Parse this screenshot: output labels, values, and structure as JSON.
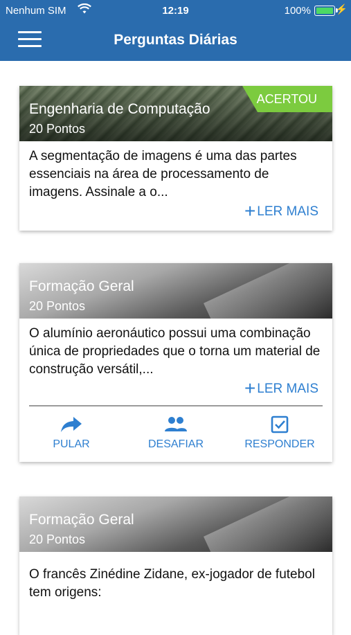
{
  "status_bar": {
    "carrier": "Nenhum SIM",
    "time": "12:19",
    "battery": "100%"
  },
  "nav": {
    "title": "Perguntas Diárias"
  },
  "cards": [
    {
      "category": "Engenharia de Computação",
      "points": "20 Pontos",
      "badge": "ACERTOU",
      "text": "A segmentação de imagens é uma das partes essenciais na área de processamento de imagens. Assinale a o...",
      "read_more": "LER MAIS"
    },
    {
      "category": "Formação Geral",
      "points": "20 Pontos",
      "text": "O alumínio aeronáutico possui uma combinação única de propriedades que o torna um material de construção versátil,...",
      "read_more": "LER MAIS",
      "actions": {
        "skip": "PULAR",
        "challenge": "DESAFIAR",
        "answer": "RESPONDER"
      }
    },
    {
      "category": "Formação Geral",
      "points": "20 Pontos",
      "text": "O francês Zinédine Zidane, ex-jogador de futebol tem origens:"
    }
  ],
  "colors": {
    "primary": "#2a6cae",
    "accent": "#2e7fd0",
    "success": "#7ccb3f"
  },
  "icons": [
    "wifi-icon",
    "battery-icon",
    "menu-icon",
    "plus-icon",
    "forward-icon",
    "group-icon",
    "checkbox-icon"
  ]
}
